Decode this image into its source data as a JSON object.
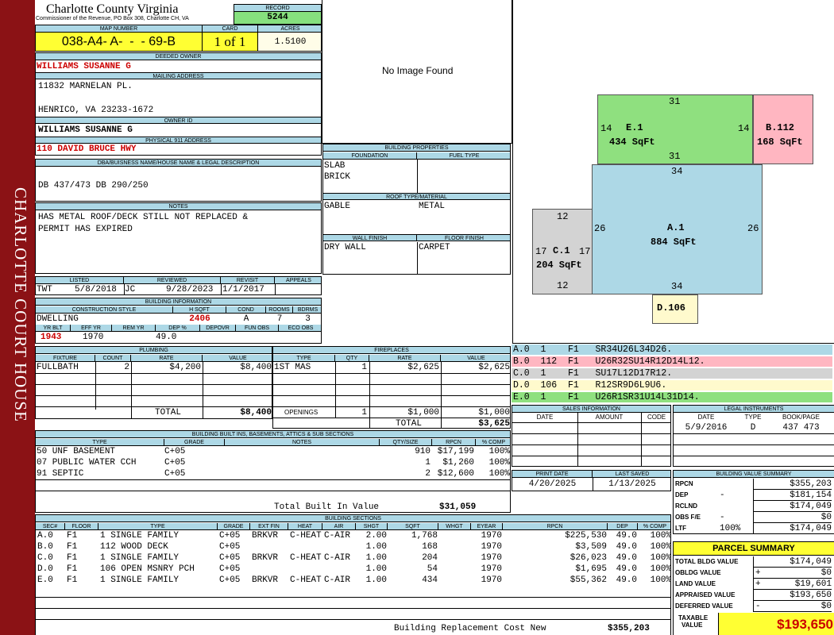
{
  "side_title": "CHARLOTTE COURT HOUSE",
  "county": {
    "title": "Charlotte County Virginia",
    "subtitle": "Commissioner of the Revenue, PO Box 308, Charlotte CH, VA"
  },
  "record": {
    "label": "RECORD",
    "value": "5244"
  },
  "map": {
    "label": "MAP NUMBER",
    "value": "038-A4- A-  -  - 69-B",
    "card_label": "CARD",
    "card": "1 of 1",
    "acres_label": "ACRES",
    "acres": "1.5100"
  },
  "deeded": {
    "label": "DEEDED OWNER",
    "value": "WILLIAMS SUSANNE G"
  },
  "mailing": {
    "label": "MAILING ADDRESS",
    "line1": "11832 MARNELAN  PL.",
    "line2": "HENRICO, VA 23233-1672"
  },
  "owner_id": {
    "label": "OWNER ID",
    "value": "WILLIAMS SUSANNE G"
  },
  "physical": {
    "label": "PHYSICAL 911 ADDRESS",
    "value": "110 DAVID BRUCE HWY"
  },
  "dba": {
    "label": "DBA/BUISNESS NAME/HOUSE NAME & LEGAL DESCRIPTION",
    "value": "DB 437/473 DB 290/250"
  },
  "notes": {
    "label": "NOTES",
    "line1": "HAS METAL ROOF/DECK STILL NOT REPLACED &",
    "line2": "PERMIT HAS EXPIRED"
  },
  "image_text": "No Image Found",
  "bp": {
    "label": "BUILDING PROPERTIES",
    "foundation_label": "FOUNDATION",
    "fuel_label": "FUEL TYPE",
    "foundation1": "SLAB",
    "foundation2": "BRICK",
    "roof_label": "ROOF TYPE/MATERIAL",
    "roof_type": "GABLE",
    "roof_material": "METAL",
    "wall_label": "WALL FINISH",
    "floor_label": "FLOOR FINISH",
    "wall": "DRY WALL",
    "floor": "CARPET"
  },
  "listed": {
    "listed_label": "LISTED",
    "reviewed_label": "REVIEWED",
    "revisit_label": "REVISIT",
    "appeals_label": "APPEALS",
    "listed_by": "TWT",
    "listed_date": "5/8/2018",
    "reviewed_by": "JC",
    "reviewed_date": "9/28/2023",
    "revisit": "1/1/2017"
  },
  "bi": {
    "label": "BUILDING INFORMATION",
    "cs_label": "CONSTRUCTION STYLE",
    "hsqft_label": "H SQFT",
    "cond_label": "COND",
    "rooms_label": "ROOMS",
    "bdrms_label": "BDRMS",
    "style": "DWELLING",
    "hsqft": "2406",
    "cond": "A",
    "rooms": "7",
    "bdrms": "3",
    "yrblt_label": "YR BLT",
    "effyr_label": "EFF YR",
    "remyr_label": "REM YR",
    "dep_label": "DEP %",
    "depovr_label": "DEPOVR",
    "funobs_label": "FUN OBS",
    "ecoobs_label": "ECO OBS",
    "yrblt": "1943",
    "effyr": "1970",
    "dep": "49.0"
  },
  "plumbing": {
    "label": "PLUMBING",
    "headers": [
      "FIXTURE",
      "COUNT",
      "RATE",
      "VALUE"
    ],
    "row": [
      "FULLBATH",
      "2",
      "$4,200",
      "$8,400"
    ],
    "total_label": "TOTAL",
    "total": "$8,400"
  },
  "fireplaces": {
    "label": "FIREPLACES",
    "headers": [
      "TYPE",
      "QTY",
      "RATE",
      "VALUE"
    ],
    "row": [
      "1ST MAS",
      "1",
      "$2,625",
      "$2,625"
    ],
    "openings_label": "OPENINGS",
    "openings": [
      "1",
      "$1,000",
      "$1,000"
    ],
    "total_label": "TOTAL",
    "total": "$3,625"
  },
  "builtins": {
    "label": "BUILDING BUILT INS, BASEMENTS, ATTICS & SUB SECTIONS",
    "headers": [
      "TYPE",
      "GRADE",
      "NOTES",
      "QTY/SIZE",
      "RPCN",
      "% COMP"
    ],
    "rows": [
      [
        "50 UNF BASEMENT",
        "C+05",
        "",
        "910",
        "$17,199",
        "100%"
      ],
      [
        "07 PUBLIC WATER CCH",
        "C+05",
        "",
        "1",
        "$1,260",
        "100%"
      ],
      [
        "91 SEPTIC",
        "C+05",
        "",
        "2",
        "$12,600",
        "100%"
      ]
    ],
    "total_label": "Total Built In Value",
    "total": "$31,059"
  },
  "sections": {
    "label": "BUILDING SECTIONS",
    "headers": [
      "SEC#",
      "FLOOR",
      "TYPE",
      "GRADE",
      "EXT FIN",
      "HEAT",
      "AIR",
      "SHGT",
      "SQFT",
      "WHGT",
      "EYEAR",
      "RPCN",
      "DEP",
      "% COMP"
    ],
    "rows": [
      [
        "A.0",
        "F1",
        "1 SINGLE FAMILY",
        "C+05",
        "BRKVR",
        "C-HEAT",
        "C-AIR",
        "2.00",
        "1,768",
        "",
        "1970",
        "$225,530",
        "49.0",
        "100%"
      ],
      [
        "B.0",
        "F1",
        "112 WOOD DECK",
        "C+05",
        "",
        "",
        "",
        "1.00",
        "168",
        "",
        "1970",
        "$3,509",
        "49.0",
        "100%"
      ],
      [
        "C.0",
        "F1",
        "1 SINGLE FAMILY",
        "C+05",
        "BRKVR",
        "C-HEAT",
        "C-AIR",
        "1.00",
        "204",
        "",
        "1970",
        "$26,023",
        "49.0",
        "100%"
      ],
      [
        "D.0",
        "F1",
        "106 OPEN MSNRY PCH",
        "C+05",
        "",
        "",
        "",
        "1.00",
        "54",
        "",
        "1970",
        "$1,695",
        "49.0",
        "100%"
      ],
      [
        "E.0",
        "F1",
        "1 SINGLE FAMILY",
        "C+05",
        "BRKVR",
        "C-HEAT",
        "C-AIR",
        "1.00",
        "434",
        "",
        "1970",
        "$55,362",
        "49.0",
        "100%"
      ]
    ],
    "brcn_label": "Building Replacement Cost New",
    "brcn": "$355,203"
  },
  "sketch": {
    "e": {
      "top": "31",
      "bottom": "31",
      "left": "14",
      "right": "14",
      "name": "E.1",
      "area": "434 SqFt",
      "color": "#8fe07f"
    },
    "b": {
      "name": "B.112",
      "area": "168 SqFt",
      "color": "#ffb6c1"
    },
    "a": {
      "top": "34",
      "bottom": "34",
      "left": "26",
      "right": "26",
      "name": "A.1",
      "area": "884 SqFt",
      "color": "#add8e6"
    },
    "c": {
      "top": "12",
      "bottom": "12",
      "left": "17",
      "right": "17",
      "name": "C.1",
      "area": "204 SqFt",
      "color": "#d3d3d3"
    },
    "d": {
      "name": "D.106",
      "color": "#fffacd"
    }
  },
  "legend": [
    {
      "text": "A.0  1    F1   SR34U26L34D26.",
      "color": "#add8e6"
    },
    {
      "text": "B.0  112  F1   U26R32SU14R12D14L12.",
      "color": "#ffb6c1"
    },
    {
      "text": "C.0  1    F1   SU17L12D17R12.",
      "color": "#d3d3d3"
    },
    {
      "text": "D.0  106  F1   R12SR9D6L9U6.",
      "color": "#fffacd"
    },
    {
      "text": "E.0  1    F1   U26R1SR31U14L31D14.",
      "color": "#8fe07f"
    }
  ],
  "sales": {
    "label": "SALES INFORMATION",
    "headers": [
      "DATE",
      "AMOUNT",
      "CODE"
    ]
  },
  "legal": {
    "label": "LEGAL INSTRUMENTS",
    "headers": [
      "DATE",
      "TYPE",
      "BOOK/PAGE"
    ],
    "row": [
      "5/9/2016",
      "D",
      "437 473"
    ]
  },
  "print": {
    "print_label": "PRINT DATE",
    "saved_label": "LAST SAVED",
    "print": "4/20/2025",
    "saved": "1/13/2025"
  },
  "bvs": {
    "label": "BUILDING VALUE SUMMARY",
    "rows": [
      [
        "RPCN",
        "",
        "$355,203"
      ],
      [
        "DEP",
        "-",
        "$181,154"
      ],
      [
        "RCLND",
        "",
        "$174,049"
      ],
      [
        "OBS F/E",
        "-",
        "$0"
      ],
      [
        "LTF",
        "100%",
        "$174,049"
      ]
    ]
  },
  "parcel": {
    "label": "PARCEL SUMMARY",
    "rows": [
      [
        "TOTAL BLDG VALUE",
        "",
        "$174,049"
      ],
      [
        "OBLDG VALUE",
        "+",
        "$0"
      ],
      [
        "LAND VALUE",
        "+",
        "$19,601"
      ],
      [
        "APPRAISED VALUE",
        "",
        "$193,650"
      ],
      [
        "DEFERRED VALUE",
        "-",
        "$0"
      ]
    ],
    "taxable_label1": "TAXABLE",
    "taxable_label2": "VALUE",
    "taxable": "$193,650"
  }
}
